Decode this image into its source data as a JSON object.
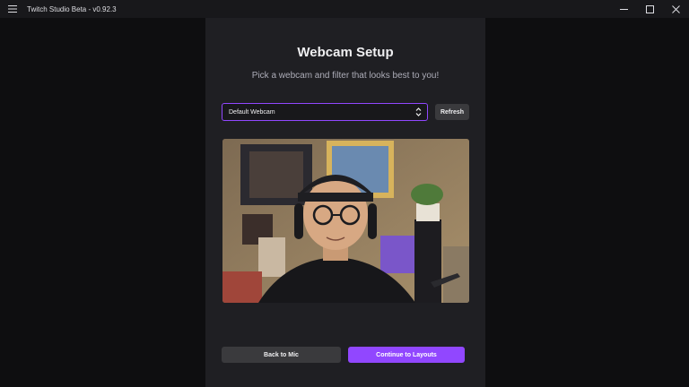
{
  "window": {
    "title": "Twitch Studio Beta - v0.92.3",
    "menu_icon": "hamburger-menu-icon",
    "controls": [
      "minimize-icon",
      "maximize-icon",
      "close-icon"
    ]
  },
  "setup": {
    "heading": "Webcam Setup",
    "subheading": "Pick a webcam and filter that looks best to you!",
    "webcam_select": {
      "selected": "Default Webcam",
      "icon": "chevron-up-down-icon"
    },
    "refresh_label": "Refresh",
    "preview": {
      "subject": "webcam-preview-image"
    },
    "back_label": "Back to Mic",
    "continue_label": "Continue to Layouts"
  },
  "colors": {
    "accent": "#9147ff",
    "panel": "#1f1f23",
    "background": "#0e0e10",
    "secondary_button": "#3a3a3d"
  }
}
